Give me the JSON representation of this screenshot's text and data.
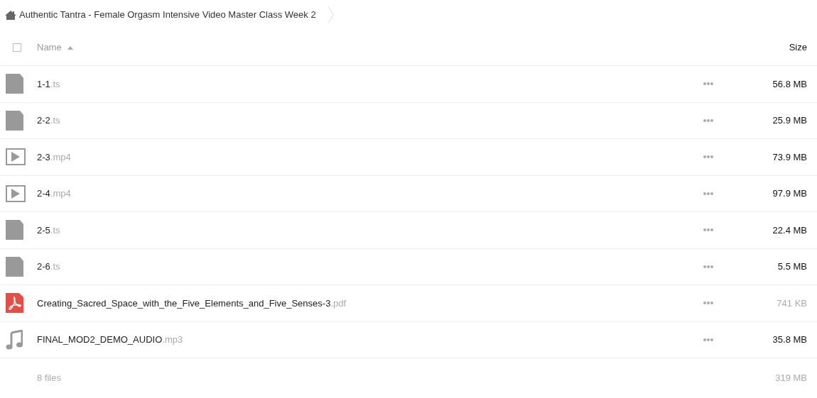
{
  "breadcrumb": {
    "title": "Authentic Tantra - Female Orgasm Intensive Video Master Class Week 2"
  },
  "header": {
    "checkbox": {
      "checked": false
    },
    "name_label": "Name",
    "size_label": "Size"
  },
  "files": [
    {
      "kind": "file",
      "name": "1-1",
      "ext": ".ts",
      "size": "56.8 MB",
      "size_muted": false
    },
    {
      "kind": "file",
      "name": "2-2",
      "ext": ".ts",
      "size": "25.9 MB",
      "size_muted": false
    },
    {
      "kind": "video",
      "name": "2-3",
      "ext": ".mp4",
      "size": "73.9 MB",
      "size_muted": false
    },
    {
      "kind": "video",
      "name": "2-4",
      "ext": ".mp4",
      "size": "97.9 MB",
      "size_muted": false
    },
    {
      "kind": "file",
      "name": "2-5",
      "ext": ".ts",
      "size": "22.4 MB",
      "size_muted": false
    },
    {
      "kind": "file",
      "name": "2-6",
      "ext": ".ts",
      "size": "5.5 MB",
      "size_muted": false
    },
    {
      "kind": "pdf",
      "name": "Creating_Sacred_Space_with_the_Five_Elements_and_Five_Senses-3",
      "ext": ".pdf",
      "size": "741 KB",
      "size_muted": true
    },
    {
      "kind": "audio",
      "name": "FINAL_MOD2_DEMO_AUDIO",
      "ext": ".mp3",
      "size": "35.8 MB",
      "size_muted": false
    }
  ],
  "footer": {
    "count": "8 files",
    "total": "319 MB"
  }
}
